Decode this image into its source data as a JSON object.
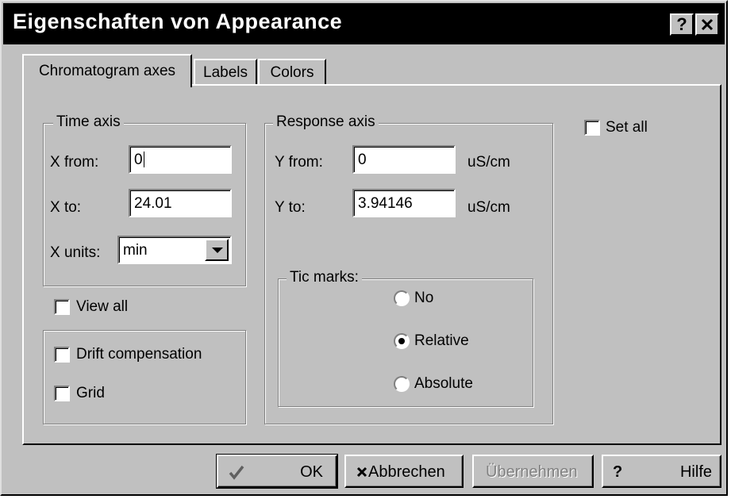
{
  "window": {
    "title": "Eigenschaften von Appearance",
    "help_button": "?",
    "close_button": "✕"
  },
  "tabs": [
    {
      "label": "Chromatogram axes",
      "active": true
    },
    {
      "label": "Labels",
      "active": false
    },
    {
      "label": "Colors",
      "active": false
    }
  ],
  "time_axis": {
    "legend": "Time axis",
    "x_from_label": "X from:",
    "x_from_value": "0",
    "x_to_label": "X to:",
    "x_to_value": "24.01",
    "x_units_label": "X units:",
    "x_units_value": "min"
  },
  "response_axis": {
    "legend": "Response axis",
    "y_from_label": "Y from:",
    "y_from_value": "0",
    "y_from_unit": "uS/cm",
    "y_to_label": "Y to:",
    "y_to_value": "3.94146",
    "y_to_unit": "uS/cm",
    "tic_marks": {
      "legend": "Tic marks:",
      "options": [
        {
          "label": "No",
          "selected": false
        },
        {
          "label": "Relative",
          "selected": true
        },
        {
          "label": "Absolute",
          "selected": false
        }
      ]
    }
  },
  "checkboxes": {
    "set_all": {
      "label": "Set all",
      "checked": false
    },
    "view_all": {
      "label": "View all",
      "checked": false
    },
    "drift_compensation": {
      "label": "Drift compensation",
      "checked": false
    },
    "grid": {
      "label": "Grid",
      "checked": false
    }
  },
  "buttons": {
    "ok": "OK",
    "cancel": "Abbrechen",
    "apply": "Übernehmen",
    "help_glyph": "?",
    "help": "Hilfe"
  },
  "icons": {
    "ok": "checkmark-icon",
    "cancel": "x-icon",
    "help": "question-icon"
  },
  "colors": {
    "face": "#c0c0c0",
    "titlebar": "#000000",
    "shadow": "#808080",
    "highlight": "#ffffff"
  }
}
